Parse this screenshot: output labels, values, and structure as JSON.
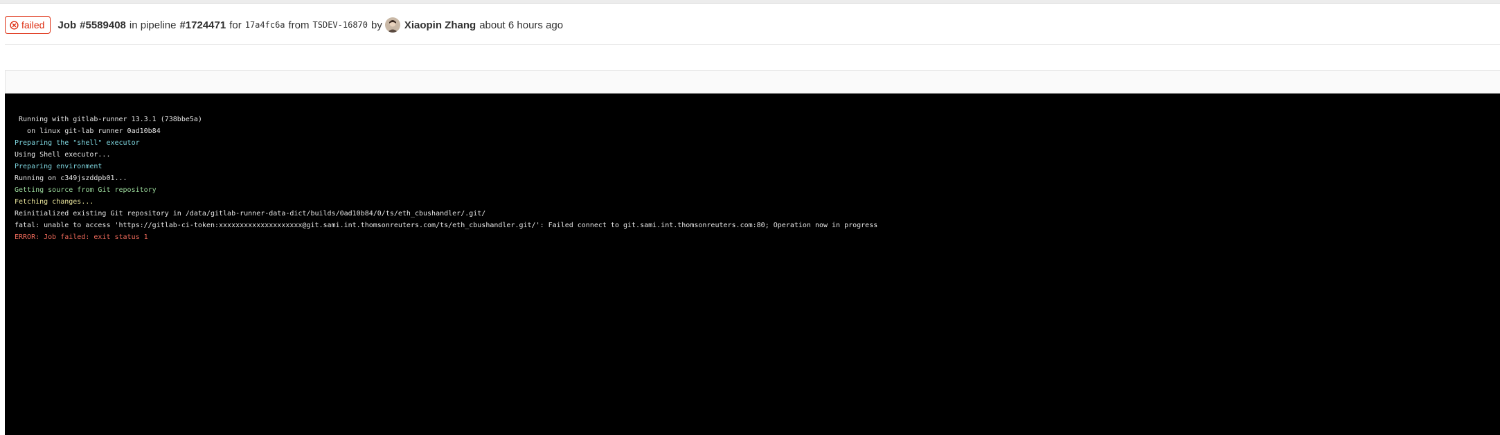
{
  "job": {
    "status": "failed",
    "label": "Job",
    "id": "#5589408",
    "in_pipeline_text": "in pipeline",
    "pipeline_id": "#1724471",
    "for_text": "for",
    "commit_sha": "17a4fc6a",
    "from_text": "from",
    "branch": "TSDEV-16870",
    "by_text": "by",
    "author": "Xiaopin Zhang",
    "time_ago": "about 6 hours ago"
  },
  "icons": {
    "status": "failed-circle-x-icon",
    "avatar": "user-avatar"
  },
  "colors": {
    "failed": "#dd2b0e",
    "log_background": "#000000",
    "log_cyan": "#7fd7e0",
    "log_green": "#9ad89a",
    "log_yellow": "#e8e39a",
    "log_red": "#ef6a5a"
  },
  "log": {
    "lines": [
      {
        "text": " Running with gitlab-runner 13.3.1 (738bbe5a)",
        "tone": "default"
      },
      {
        "text": "   on linux git-lab runner 0ad10b84",
        "tone": "default"
      },
      {
        "text": "Preparing the \"shell\" executor",
        "tone": "cyan"
      },
      {
        "text": "Using Shell executor...",
        "tone": "default"
      },
      {
        "text": "Preparing environment",
        "tone": "cyan"
      },
      {
        "text": "Running on c349jszddpb01...",
        "tone": "default"
      },
      {
        "text": "Getting source from Git repository",
        "tone": "green"
      },
      {
        "text": "Fetching changes...",
        "tone": "yellow"
      },
      {
        "text": "Reinitialized existing Git repository in /data/gitlab-runner-data-dict/builds/0ad10b84/0/ts/eth_cbushandler/.git/",
        "tone": "default"
      },
      {
        "text": "fatal: unable to access 'https://gitlab-ci-token:xxxxxxxxxxxxxxxxxxxx@git.sami.int.thomsonreuters.com/ts/eth_cbushandler.git/': Failed connect to git.sami.int.thomsonreuters.com:80; Operation now in progress",
        "tone": "default"
      },
      {
        "text": "ERROR: Job failed: exit status 1",
        "tone": "red"
      }
    ]
  }
}
